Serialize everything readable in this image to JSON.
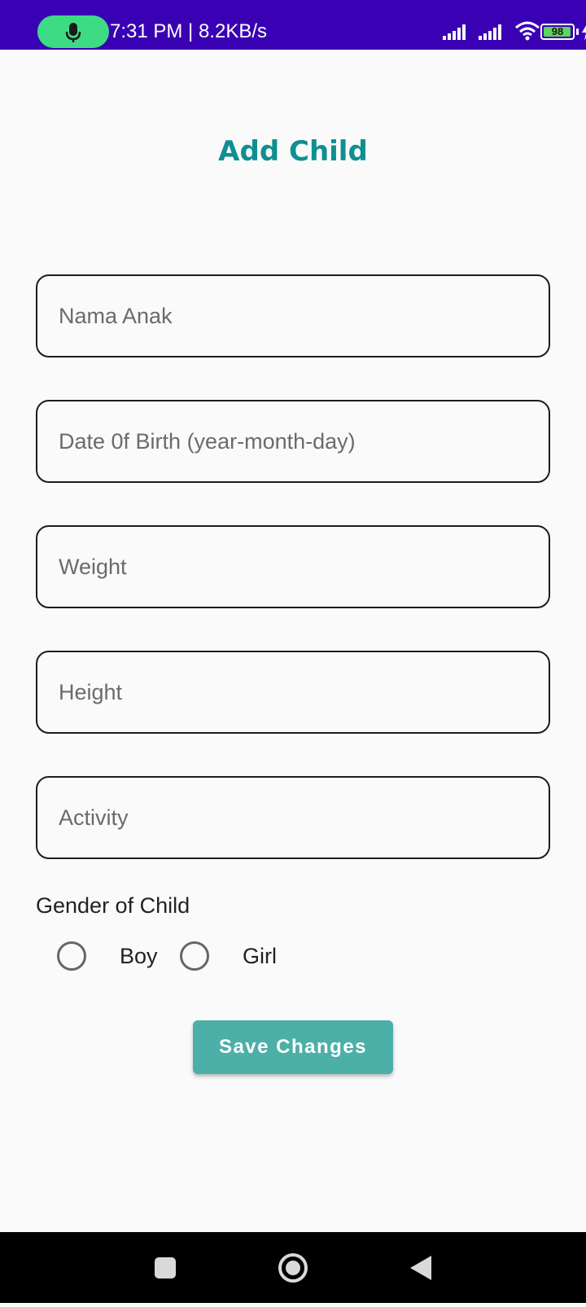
{
  "status_bar": {
    "time_speed": "7:31 PM | 8.2KB/s",
    "battery_level": "98",
    "battery_fraction": 0.98,
    "accent_color": "#3a00b4",
    "icons": [
      "mic-icon",
      "signal-icon",
      "signal-icon",
      "wifi-icon",
      "battery-icon",
      "charging-icon"
    ]
  },
  "page": {
    "title": "Add Child",
    "title_color": "#0f8f92"
  },
  "form": {
    "fields": [
      {
        "placeholder": "Nama Anak",
        "value": ""
      },
      {
        "placeholder": "Date 0f Birth (year-month-day)",
        "value": ""
      },
      {
        "placeholder": "Weight",
        "value": ""
      },
      {
        "placeholder": "Height",
        "value": ""
      },
      {
        "placeholder": "Activity",
        "value": ""
      }
    ],
    "gender_label": "Gender of Child",
    "gender_options": [
      "Boy",
      "Girl"
    ],
    "gender_selected": null,
    "save_label": "Save Changes",
    "save_color": "#4cb0a8"
  },
  "nav_bar": {
    "icons": [
      "recents-icon",
      "home-icon",
      "back-icon"
    ]
  }
}
